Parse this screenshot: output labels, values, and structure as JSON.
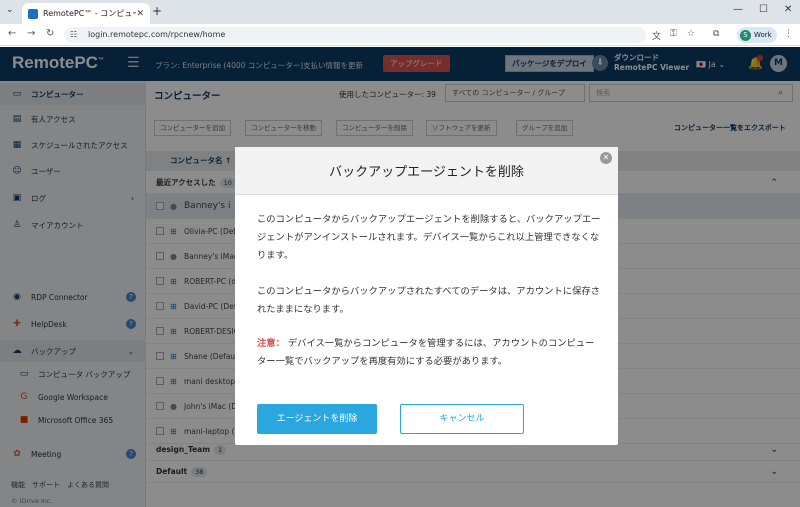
{
  "browser": {
    "tab_title": "RemotePC™ - コンピューター",
    "url": "login.remotepc.com/rpcnew/home",
    "profile_initial": "S",
    "profile_label": "Work"
  },
  "header": {
    "logo": "RemotePC",
    "logo_tm": "™",
    "plan": "プラン: Enterprise (4000 コンピューター)",
    "pay_label": "支払い情報を更新",
    "upgrade_label": "アップグレード",
    "deploy_label": "パッケージをデプロイ",
    "download_line1": "ダウンロード",
    "download_line2": "RemotePC Viewer",
    "lang": "Ja",
    "avatar": "M"
  },
  "sidebar": {
    "items": [
      {
        "label": "コンピューター",
        "icon": "monitor-icon"
      },
      {
        "label": "有人アクセス",
        "icon": "attended-icon"
      },
      {
        "label": "スケジュールされたアクセス",
        "icon": "calendar-icon"
      },
      {
        "label": "ユーザー",
        "icon": "users-icon"
      },
      {
        "label": "ログ",
        "icon": "log-icon"
      },
      {
        "label": "マイアカウント",
        "icon": "account-icon"
      }
    ],
    "rdp": "RDP Connector",
    "helpdesk": "HelpDesk",
    "backup": "バックアップ",
    "backup_items": [
      "コンピュータ バックアップ",
      "Google Workspace",
      "Microsoft Office 365"
    ],
    "meeting": "Meeting",
    "footer": "機能　サポート　よくある質問",
    "copyright": "© IDrive Inc."
  },
  "main": {
    "title": "コンピューター",
    "used": "使用したコンピューター: 39",
    "group_select": "すべての コンピューター / グループ",
    "search_placeholder": "検索",
    "toolbar": [
      "コンピューターを追加",
      "コンピューターを移動",
      "コンピューターを削除",
      "ソフトウェアを更新",
      "グループを追加"
    ],
    "export": "コンピューター一覧をエクスポート",
    "col_name": "コンピュータ名 ↑",
    "recent_group": "最近アクセスした",
    "recent_count": "10",
    "rows": [
      "Banney's i",
      "Olivia-PC (Defa",
      "Banney's iMac",
      "ROBERT-PC (de",
      "David-PC (Defa",
      "ROBERT-DESIG",
      "Shane (Default",
      "mani desktop (",
      "John's iMac (D",
      "mani-laptop (D"
    ],
    "group2": "design_Team",
    "group2_count": "1",
    "group3": "Default",
    "group3_count": "38"
  },
  "modal": {
    "title": "バックアップエージェントを削除",
    "p1": "このコンピュータからバックアップエージェントを削除すると、バックアップエージェントがアンインストールされます。デバイス一覧からこれ以上管理できなくなります。",
    "p2": "このコンピュータからバックアップされたすべてのデータは、アカウントに保存されたままになります。",
    "note_label": "注意：",
    "note": " デバイス一覧からコンピュータを管理するには、アカウントのコンピューター一覧でバックアップを再度有効にする必要があります。",
    "confirm_label": "エージェントを削除",
    "cancel_label": "キャンセル"
  },
  "colors": {
    "header_bg": "#0c3b66",
    "accent": "#2aa7df",
    "danger": "#d9534f"
  }
}
